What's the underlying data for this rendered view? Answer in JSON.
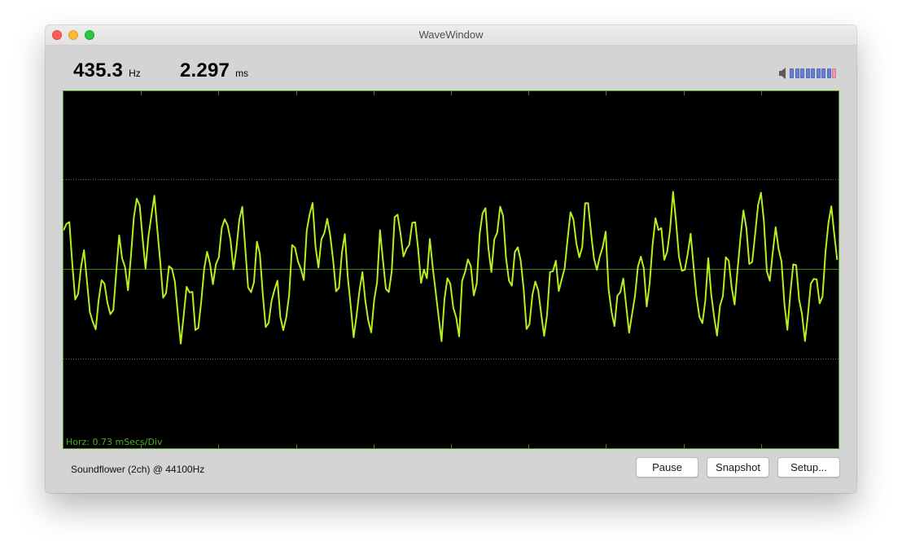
{
  "window": {
    "title": "WaveWindow"
  },
  "readouts": {
    "frequency_value": "435.3",
    "frequency_unit": "Hz",
    "period_value": "2.297",
    "period_unit": "ms"
  },
  "volume": {
    "icon": "speaker-icon",
    "level_fraction": 1.0,
    "bar_color": "#6b7fd0",
    "peak_color": "#e99ab0"
  },
  "scope": {
    "horizontal_scale_label": "Horz: 0.73 mSecs/Div",
    "trace_color": "#b6f01e",
    "grid_color": "#3f9a10",
    "background_color": "#000000"
  },
  "status": {
    "device_label": "Soundflower (2ch) @ 44100Hz"
  },
  "buttons": {
    "pause": "Pause",
    "snapshot": "Snapshot",
    "setup": "Setup..."
  }
}
